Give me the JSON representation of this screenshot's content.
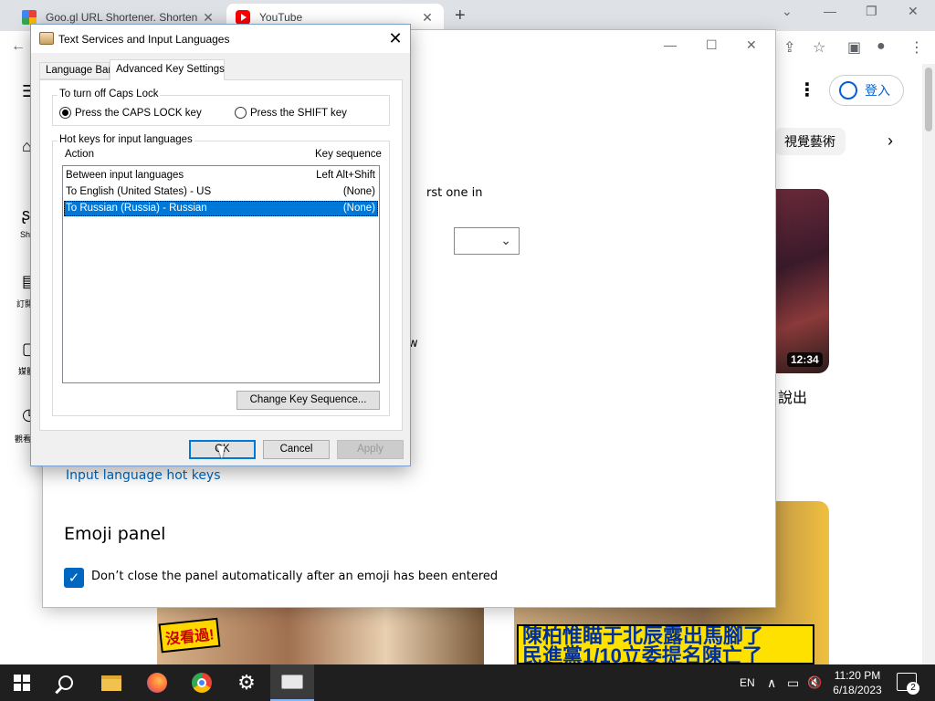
{
  "browser": {
    "tabs": [
      {
        "title": "Goo.gl URL Shortener. Shorten U",
        "close": "✕"
      },
      {
        "title": "YouTube",
        "close": "✕"
      }
    ],
    "new_tab": "+",
    "window_controls": {
      "collapse": "⌄",
      "minimize": "—",
      "restore": "❐",
      "close": "✕"
    },
    "toolbar_icons": {
      "back": "←",
      "share": "⇪",
      "star": "☆",
      "sidepanel": "▣",
      "profile": "●",
      "menu": "⋮"
    }
  },
  "youtube": {
    "signin_label": "登入",
    "chip_label": "視覺藝術",
    "video_duration": "12:34",
    "title_fragment": "說出",
    "thumb2_label": "沒看過!",
    "thumb3_caption_line1": "陳柏惟瞄于北辰露出馬腳了",
    "thumb3_caption_line2": "民進黨1/10立委提名陳亡了",
    "left_nav": [
      {
        "icon": "⌂",
        "label": ""
      },
      {
        "icon": "ʂ",
        "label": "Sh"
      },
      {
        "icon": "▤",
        "label": "訂閱"
      },
      {
        "icon": "▢",
        "label": "媒體"
      },
      {
        "icon": "◷",
        "label": "觀看"
      }
    ]
  },
  "settings": {
    "window_controls": {
      "minimize": "—",
      "maximize": "☐",
      "close": "✕"
    },
    "fragment_first": "rst one in",
    "fragment_w": "w",
    "hot_keys_link": "Input language hot keys",
    "emoji_heading": "Emoji panel",
    "emoji_checkbox_label": "Don’t close the panel automatically after an emoji has been entered",
    "emoji_checkbox_checked": true
  },
  "dialog": {
    "title": "Text Services and Input Languages",
    "close": "✕",
    "tabs": [
      {
        "label": "Language Bar",
        "active": false
      },
      {
        "label": "Advanced Key Settings",
        "active": true
      }
    ],
    "caps_group": {
      "label": "To turn off Caps Lock",
      "options": [
        {
          "label": "Press the CAPS LOCK key",
          "selected": true
        },
        {
          "label": "Press the SHIFT key",
          "selected": false
        }
      ]
    },
    "hotkeys_group": {
      "label": "Hot keys for input languages",
      "col_action": "Action",
      "col_key": "Key sequence",
      "rows": [
        {
          "action": "Between input languages",
          "key": "Left Alt+Shift",
          "selected": false
        },
        {
          "action": "To English (United States) - US",
          "key": "(None)",
          "selected": false
        },
        {
          "action": "To Russian (Russia) - Russian",
          "key": "(None)",
          "selected": true
        }
      ],
      "change_button": "Change Key Sequence..."
    },
    "buttons": {
      "ok": "OK",
      "cancel": "Cancel",
      "apply": "Apply"
    }
  },
  "taskbar": {
    "lang": "EN",
    "time": "11:20 PM",
    "date": "6/18/2023",
    "notification_count": "2",
    "tray_icons": {
      "chevron": "∧",
      "network": "▭",
      "volume": "🔇"
    }
  }
}
